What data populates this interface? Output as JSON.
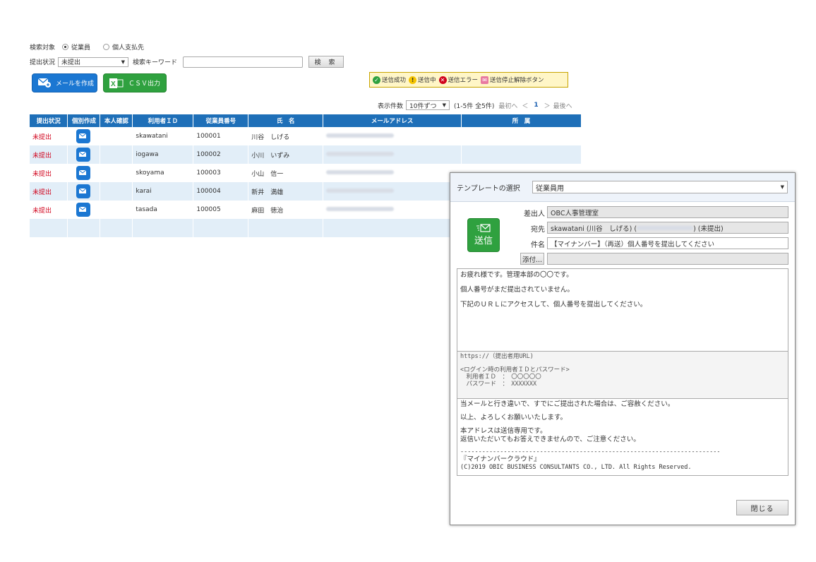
{
  "search": {
    "target_label": "検索対象",
    "target_options": [
      "従業員",
      "個人支払先"
    ],
    "status_label": "提出状況",
    "status_value": "未提出",
    "keyword_label": "検索キーワード",
    "keyword_value": "",
    "search_button": "検 索"
  },
  "actions": {
    "mail_button": "メールを作成",
    "csv_button": "ＣＳＶ出力"
  },
  "legend": {
    "success": "送信成功",
    "sending": "送信中",
    "error": "送信エラー",
    "stop": "送信停止解除ボタン"
  },
  "pager": {
    "count_label": "表示件数",
    "per_page": "10件ずつ",
    "summary": "(1-5件 全5件)",
    "first": "最初へ",
    "prev": "＜",
    "current": "1",
    "next": "＞",
    "last": "最後へ"
  },
  "table": {
    "headers": [
      "提出状況",
      "個別作成",
      "本人確認",
      "利用者ＩＤ",
      "従業員番号",
      "氏　名",
      "メールアドレス",
      "所　属"
    ],
    "rows": [
      {
        "status": "未提出",
        "user_id": "skawatani",
        "emp_no": "100001",
        "name": "川谷　しげる"
      },
      {
        "status": "未提出",
        "user_id": "iogawa",
        "emp_no": "100002",
        "name": "小川　いずみ"
      },
      {
        "status": "未提出",
        "user_id": "skoyama",
        "emp_no": "100003",
        "name": "小山　信一"
      },
      {
        "status": "未提出",
        "user_id": "karai",
        "emp_no": "100004",
        "name": "新井　満雄"
      },
      {
        "status": "未提出",
        "user_id": "tasada",
        "emp_no": "100005",
        "name": "麻田　徳治"
      }
    ]
  },
  "modal": {
    "template_label": "テンプレートの選択",
    "template_value": "従業員用",
    "send_button": "送信",
    "sender_label": "差出人",
    "sender_value": "OBC人事管理室",
    "to_label": "宛先",
    "to_value_a": "skawatani (川谷　しげる) (",
    "to_value_b": ") (未提出)",
    "subject_label": "件名",
    "subject_value": "【マイナンバー】（再送）個人番号を提出してください",
    "attach_button": "添付...",
    "body_lines": [
      "お疲れ様です。管理本部の〇〇です。",
      "個人番号がまだ提出されていません。",
      "下記のＵＲＬにアクセスして、個人番号を提出してください。"
    ],
    "url_line": "https://（提出者用URL)",
    "login_lines": [
      "<ログイン時の利用者ＩＤとパスワード>",
      "　利用者ＩＤ　：　〇〇〇〇〇",
      "　パスワード　：　XXXXXXX"
    ],
    "footer_lines": [
      "当メールと行き違いで、すでにご提出された場合は、ご容赦ください。",
      "以上、よろしくお願いいたします。",
      "本アドレスは送信専用です。",
      "返信いただいてもお答えできませんので、ご注意ください。"
    ],
    "divider": "------------------------------------------------------------------------",
    "signature": "『マイナンバークラウド』",
    "copyright": "(C)2019 OBIC BUSINESS CONSULTANTS CO., LTD. All Rights Reserved.",
    "close_button": "閉じる"
  },
  "colors": {
    "header_blue": "#1e6fb8",
    "status_red": "#d0021b",
    "row_alt": "#e2eef8",
    "send_green": "#2fa13f"
  }
}
